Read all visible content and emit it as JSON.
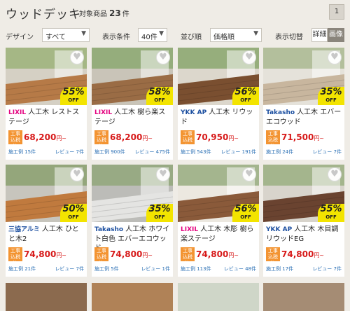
{
  "header": {
    "title": "ウッドデッキ",
    "count_label": "対象商品",
    "count_value": "23",
    "count_unit": "件",
    "page": "1"
  },
  "controls": {
    "design_label": "デザイン",
    "design_value": "すべて",
    "display_label": "表示条件",
    "display_value": "40件",
    "sort_label": "並び順",
    "sort_value": "価格順",
    "view_label": "表示切替",
    "view_detail": "詳細",
    "view_image": "画像",
    "caret": "▼"
  },
  "colors": {
    "accent": "#f39432",
    "price": "#d71a1a",
    "discount": "#f3e400",
    "link": "#2a6fb4"
  },
  "products": [
    {
      "brand": "LIXIL",
      "brand_color": "#e4007f",
      "name": "人工木 レストステージ",
      "discount": "55%",
      "off": "OFF",
      "tag": "工事込税込",
      "price": "68,200",
      "price_unit": "円~",
      "installs": "施工例 15件",
      "reviews": "レビュー 7件"
    },
    {
      "brand": "LIXIL",
      "brand_color": "#e4007f",
      "name": "人工木 樹ら楽ステージ",
      "discount": "58%",
      "off": "OFF",
      "tag": "工事込税込",
      "price": "68,200",
      "price_unit": "円~",
      "installs": "施工例 900件",
      "reviews": "レビュー 475件"
    },
    {
      "brand": "YKK AP",
      "brand_color": "#1c4fa0",
      "name": "人工木 リウッド",
      "discount": "56%",
      "off": "OFF",
      "tag": "工事込税込",
      "price": "70,950",
      "price_unit": "円~",
      "installs": "施工例 543件",
      "reviews": "レビュー 191件"
    },
    {
      "brand": "Takasho",
      "brand_color": "#1c4fa0",
      "name": "人工木 エバーエコウッド",
      "discount": "35%",
      "off": "OFF",
      "tag": "工事込税込",
      "price": "71,500",
      "price_unit": "円~",
      "installs": "施工例 24件",
      "reviews": "レビュー 7件"
    },
    {
      "brand": "三協アルミ",
      "brand_color": "#1c4fa0",
      "name": "人工木 ひとと木2",
      "discount": "50%",
      "off": "OFF",
      "tag": "工事込税込",
      "price": "74,800",
      "price_unit": "円~",
      "installs": "施工例 21件",
      "reviews": "レビュー 7件"
    },
    {
      "brand": "Takasho",
      "brand_color": "#1c4fa0",
      "name": "人工木 ホワイト白色 エバーエコウッド",
      "discount": "35%",
      "off": "OFF",
      "tag": "工事込税込",
      "price": "74,800",
      "price_unit": "円~",
      "installs": "施工例 5件",
      "reviews": "レビュー 1件"
    },
    {
      "brand": "LIXIL",
      "brand_color": "#e4007f",
      "name": "人工木 木彫 樹ら楽ステージ",
      "discount": "56%",
      "off": "OFF",
      "tag": "工事込税込",
      "price": "74,800",
      "price_unit": "円~",
      "installs": "施工例 113件",
      "reviews": "レビュー 48件"
    },
    {
      "brand": "YKK AP",
      "brand_color": "#1c4fa0",
      "name": "人工木 木目調 リウッドEG",
      "discount": "55%",
      "off": "OFF",
      "tag": "工事込税込",
      "price": "74,800",
      "price_unit": "円~",
      "installs": "施工例 17件",
      "reviews": "レビュー 7件"
    }
  ]
}
